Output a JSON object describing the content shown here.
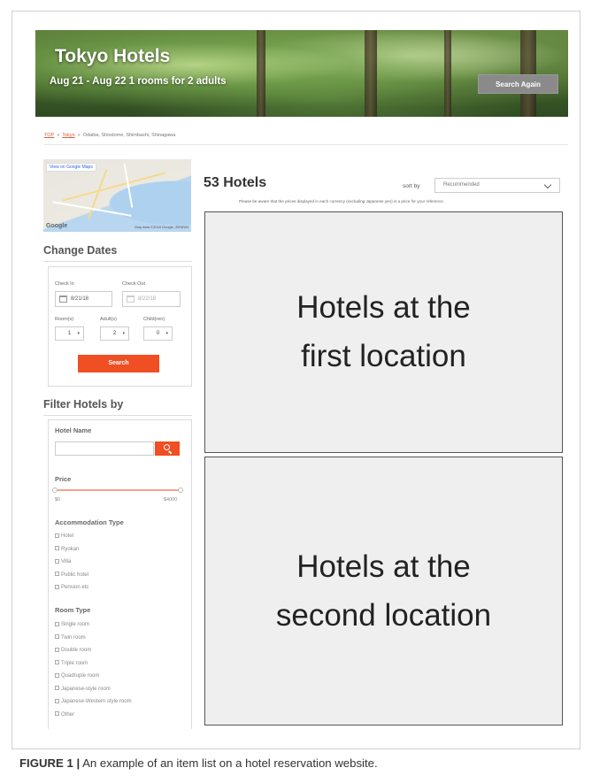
{
  "banner": {
    "title": "Tokyo Hotels",
    "subtitle": "Aug 21 - Aug 22  1 rooms for 2 adults",
    "search_again": "Search Again"
  },
  "breadcrumb": {
    "top": "TOP",
    "city": "Tokyo",
    "area": "Odaiba, Shiodome, Shimbashi, Shinagawa"
  },
  "map": {
    "view_link": "View on Google Maps",
    "brand": "Google",
    "copyright": "Map data ©2018 Google, ZENRIN"
  },
  "change_dates": {
    "heading": "Change Dates",
    "check_in_label": "Check In",
    "check_out_label": "Check Out",
    "check_in_value": "8/21/18",
    "check_out_value": "8/22/18",
    "rooms_label": "Room(s)",
    "adults_label": "Adult(s)",
    "children_label": "Child(ren)",
    "rooms_value": "1",
    "adults_value": "2",
    "children_value": "0",
    "search_button": "Search"
  },
  "filters": {
    "heading": "Filter Hotels by",
    "hotel_name_label": "Hotel Name",
    "hotel_name_value": "",
    "price_label": "Price",
    "price_min": "$0",
    "price_max": "$4000",
    "accommodation_label": "Accommodation Type",
    "accommodation_types": [
      "Hotel",
      "Ryokan",
      "Villa",
      "Public hotel",
      "Pension etc"
    ],
    "room_type_label": "Room Type",
    "room_types": [
      "Single room",
      "Twin room",
      "Double room",
      "Triple room",
      "Quadruple room",
      "Japanese-style room",
      "Japanese-Western style room",
      "Other"
    ]
  },
  "results": {
    "count": "53 Hotels",
    "sort_label": "sort by",
    "sort_value": "Recommended",
    "notice": "Please be aware that the prices displayed in each currency (excluding Japanese yen) is a price for your reference.",
    "block1_line1": "Hotels at the",
    "block1_line2": "first location",
    "block2_line1": "Hotels at the",
    "block2_line2": "second location"
  },
  "caption": {
    "label": "FIGURE 1 |",
    "text": " An example of an item list on a hotel reservation website."
  },
  "colors": {
    "accent": "#f04e23",
    "search_again_bg": "#8a8a8a",
    "placeholder_bg": "#efefef"
  }
}
